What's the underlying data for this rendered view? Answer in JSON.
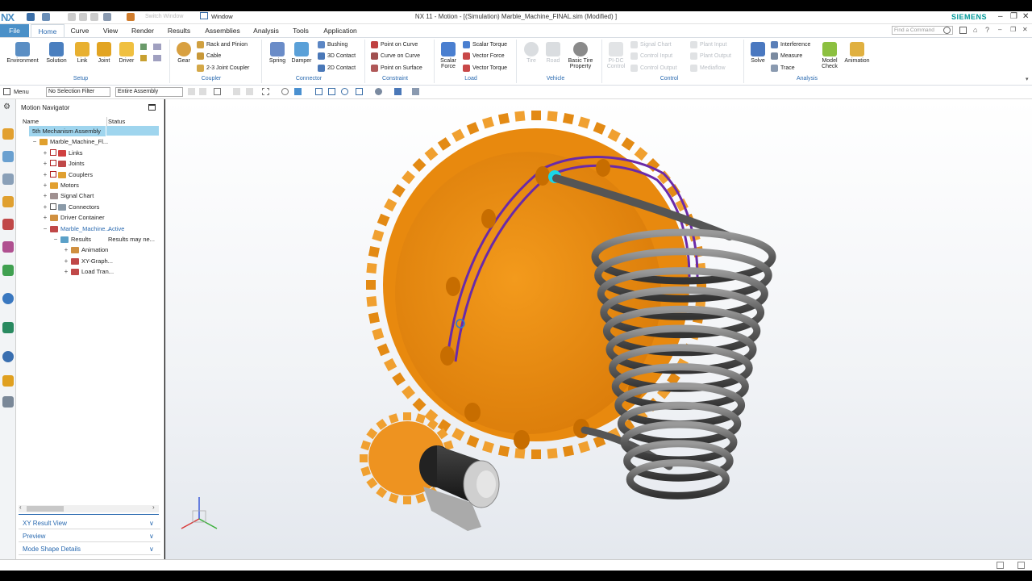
{
  "app": {
    "logo": "NX",
    "window_title": "NX 11 - Motion - [(Simulation) Marble_Machine_FINAL.sim (Modified) ]",
    "brand": "SIEMENS",
    "window_menu": "Window",
    "switch_window": "Switch Window",
    "find_command_placeholder": "Find a Command"
  },
  "menu_tabs": [
    "File",
    "Home",
    "Curve",
    "View",
    "Render",
    "Results",
    "Assemblies",
    "Analysis",
    "Tools",
    "Application"
  ],
  "ribbon": {
    "setup": {
      "label": "Setup",
      "buttons": [
        "Environment",
        "Solution",
        "Link",
        "Joint",
        "Driver"
      ]
    },
    "coupler": {
      "label": "Coupler",
      "gear": "Gear",
      "rack": "Rack and Pinion",
      "cable": "Cable",
      "joint_coupler": "2-3 Joint Coupler"
    },
    "connector": {
      "label": "Connector",
      "spring": "Spring",
      "damper": "Damper",
      "bushing": "Bushing",
      "contact3d": "3D Contact",
      "contact2d": "2D Contact"
    },
    "constraint": {
      "label": "Constraint",
      "poc": "Point on Curve",
      "coc": "Curve on Curve",
      "pos": "Point on Surface"
    },
    "load": {
      "label": "Load",
      "scalar_force": "Scalar Force",
      "scalar_torque": "Scalar Torque",
      "vector_force": "Vector Force",
      "vector_torque": "Vector Torque"
    },
    "vehicle": {
      "label": "Vehicle",
      "tire": "Tire",
      "road": "Road",
      "basic_tire": "Basic Tire Property"
    },
    "control": {
      "label": "Control",
      "pid": "PI-DC Control",
      "signal_chart": "Signal Chart",
      "control_input": "Control Input",
      "control_output": "Control Output",
      "plant_input": "Plant Input",
      "plant_output": "Plant Output",
      "mediaflow": "Mediaflow"
    },
    "analysis": {
      "label": "Analysis",
      "solve": "Solve",
      "interference": "Interference",
      "measure": "Measure",
      "trace": "Trace",
      "model_check": "Model Check",
      "animation": "Animation"
    }
  },
  "toolbar2": {
    "menu": "Menu",
    "selection_filter": "No Selection Filter",
    "assembly_scope": "Entire Assembly"
  },
  "navigator": {
    "title": "Motion Navigator",
    "col_name": "Name",
    "col_status": "Status",
    "rows": [
      {
        "label": "5th Mechanism Assembly",
        "status": "",
        "indent": 0
      },
      {
        "label": "Marble_Machine_Fl...",
        "status": "",
        "indent": 1
      },
      {
        "label": "Links",
        "status": "",
        "indent": 2
      },
      {
        "label": "Joints",
        "status": "",
        "indent": 2
      },
      {
        "label": "Couplers",
        "status": "",
        "indent": 2
      },
      {
        "label": "Motors",
        "status": "",
        "indent": 2
      },
      {
        "label": "Signal Chart",
        "status": "",
        "indent": 2
      },
      {
        "label": "Connectors",
        "status": "",
        "indent": 2
      },
      {
        "label": "Driver Container",
        "status": "",
        "indent": 2
      },
      {
        "label": "Marble_Machine...",
        "status": "Active",
        "indent": 2
      },
      {
        "label": "Results",
        "status": "Results may ne...",
        "indent": 3
      },
      {
        "label": "Animation",
        "status": "",
        "indent": 4
      },
      {
        "label": "XY-Graph...",
        "status": "",
        "indent": 4
      },
      {
        "label": "Load Tran...",
        "status": "",
        "indent": 4
      }
    ],
    "panels": [
      "XY Result View",
      "Preview",
      "Mode Shape Details"
    ]
  }
}
